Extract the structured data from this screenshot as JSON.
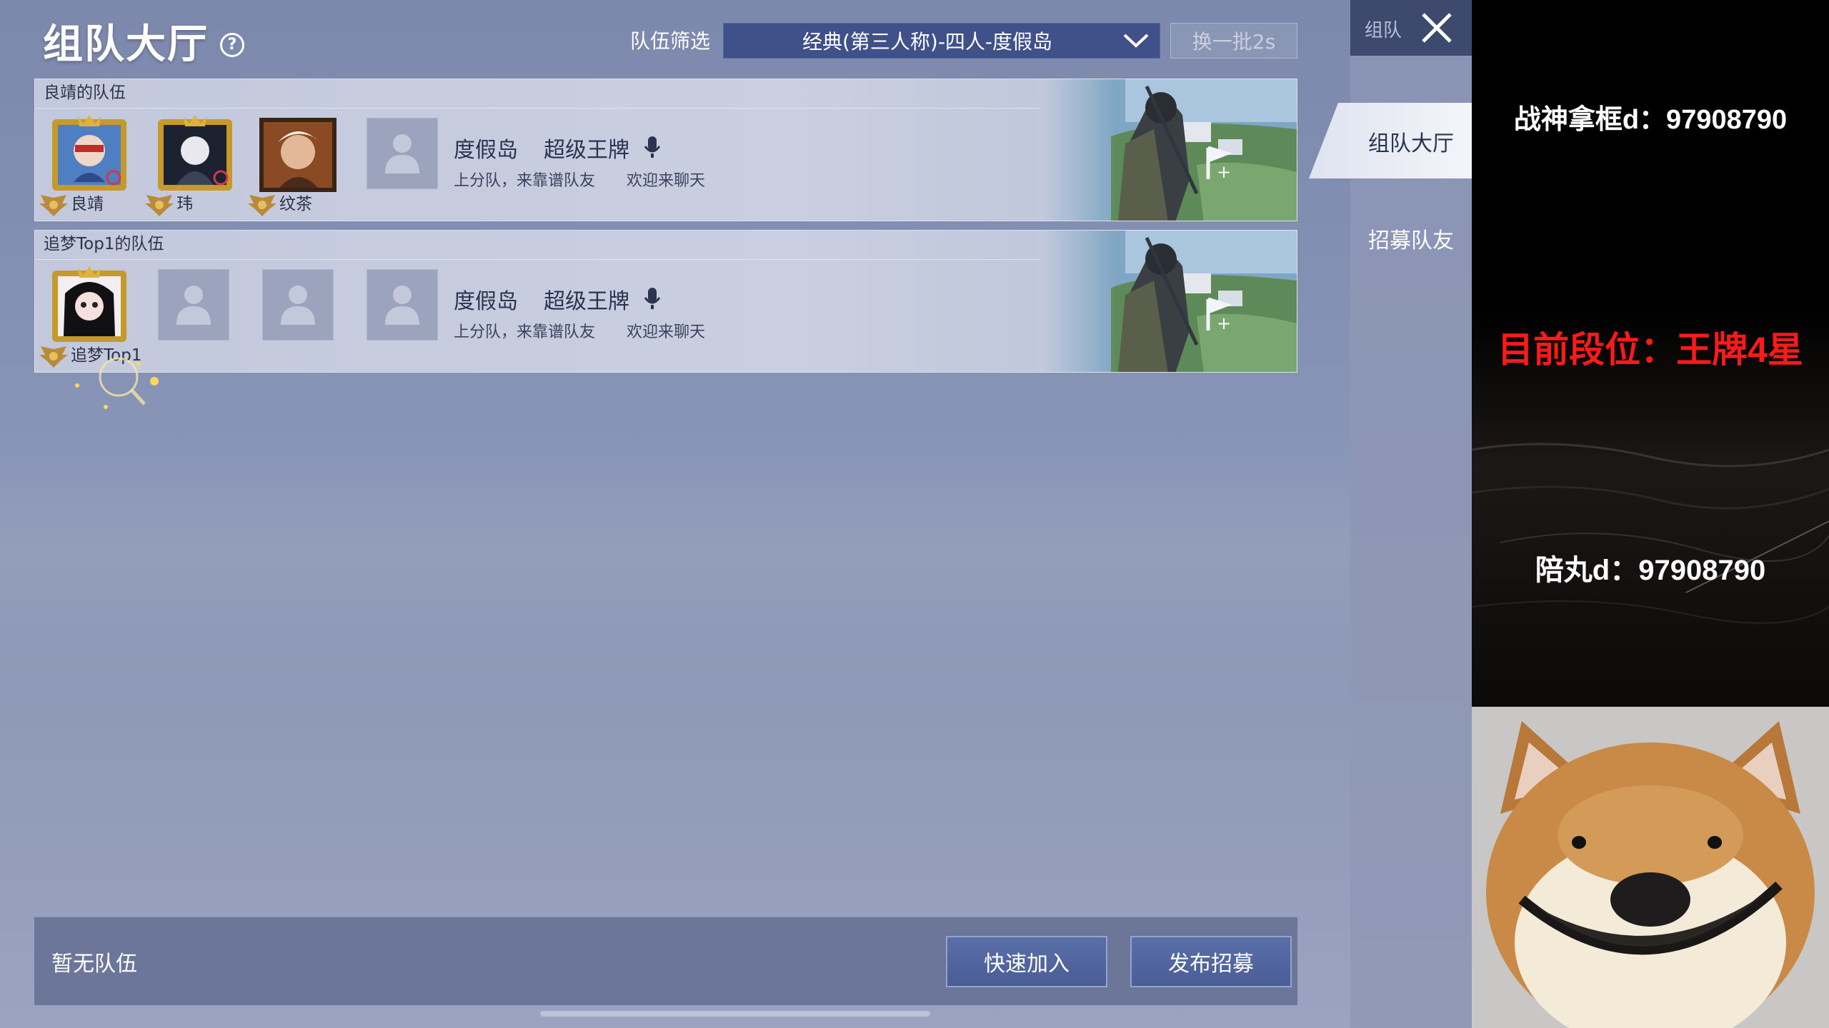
{
  "header": {
    "title": "组队大厅",
    "filter_label": "队伍筛选",
    "filter_value": "经典(第三人称)-四人-度假岛",
    "refresh_label": "换一批2s"
  },
  "teams": [
    {
      "title": "良靖的队伍",
      "members": [
        "良靖",
        "玮",
        "纹茶"
      ],
      "mode": "度假岛",
      "tier": "超级王牌",
      "desc": "上分队，来靠谱队友",
      "desc2": "欢迎来聊天"
    },
    {
      "title": "追梦Top1的队伍",
      "members": [
        "追梦Top1"
      ],
      "mode": "度假岛",
      "tier": "超级王牌",
      "desc": "上分队，来靠谱队友",
      "desc2": "欢迎来聊天"
    }
  ],
  "bottom": {
    "no_team": "暂无队伍",
    "quick_join": "快速加入",
    "post_recruit": "发布招募"
  },
  "sidenav": {
    "top_label": "组队",
    "items": [
      "组队大厅",
      "招募队友"
    ]
  },
  "overlay": {
    "line1": "战神拿框d：97908790",
    "line2": "目前段位：王牌4星",
    "line3": "陪丸d：97908790"
  },
  "colors": {
    "accent_button": "#4a5d96",
    "overlay_red": "#ff1a1a",
    "main_bg": "#8894b6"
  }
}
